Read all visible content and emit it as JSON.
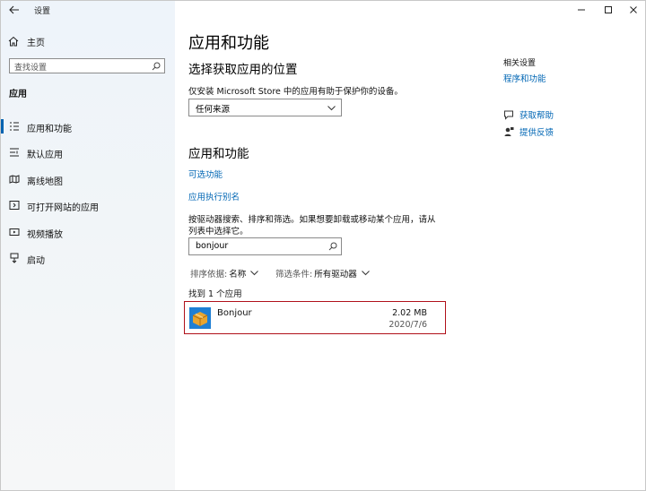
{
  "window": {
    "title": "设置"
  },
  "sidebar": {
    "home": "主页",
    "search_placeholder": "查找设置",
    "section": "应用",
    "items": [
      {
        "label": "应用和功能",
        "icon": "apps-features-icon",
        "active": true
      },
      {
        "label": "默认应用",
        "icon": "default-apps-icon",
        "active": false
      },
      {
        "label": "离线地图",
        "icon": "offline-maps-icon",
        "active": false
      },
      {
        "label": "可打开网站的应用",
        "icon": "apps-for-websites-icon",
        "active": false
      },
      {
        "label": "视频播放",
        "icon": "video-playback-icon",
        "active": false
      },
      {
        "label": "启动",
        "icon": "startup-icon",
        "active": false
      }
    ]
  },
  "main": {
    "title": "应用和功能",
    "install_section": {
      "heading": "选择获取应用的位置",
      "description": "仅安装 Microsoft Store 中的应用有助于保护你的设备。",
      "dropdown_value": "任何来源"
    },
    "apps_section": {
      "heading": "应用和功能",
      "link_optional": "可选功能",
      "link_alias": "应用执行别名",
      "description_line1": "按驱动器搜索、排序和筛选。如果想要卸载或移动某个应用，请从",
      "description_line2": "列表中选择它。",
      "search_value": "bonjour",
      "sort_label": "排序依据:",
      "sort_value": "名称",
      "filter_label": "筛选条件:",
      "filter_value": "所有驱动器",
      "found_text": "找到 1 个应用"
    },
    "app": {
      "name": "Bonjour",
      "size": "2.02 MB",
      "date": "2020/7/6"
    }
  },
  "related": {
    "heading": "相关设置",
    "link": "程序和功能",
    "help": "获取帮助",
    "feedback": "提供反馈"
  },
  "colors": {
    "accent": "#0063b1",
    "link": "#0066b4",
    "highlight_border": "#b0101a"
  }
}
